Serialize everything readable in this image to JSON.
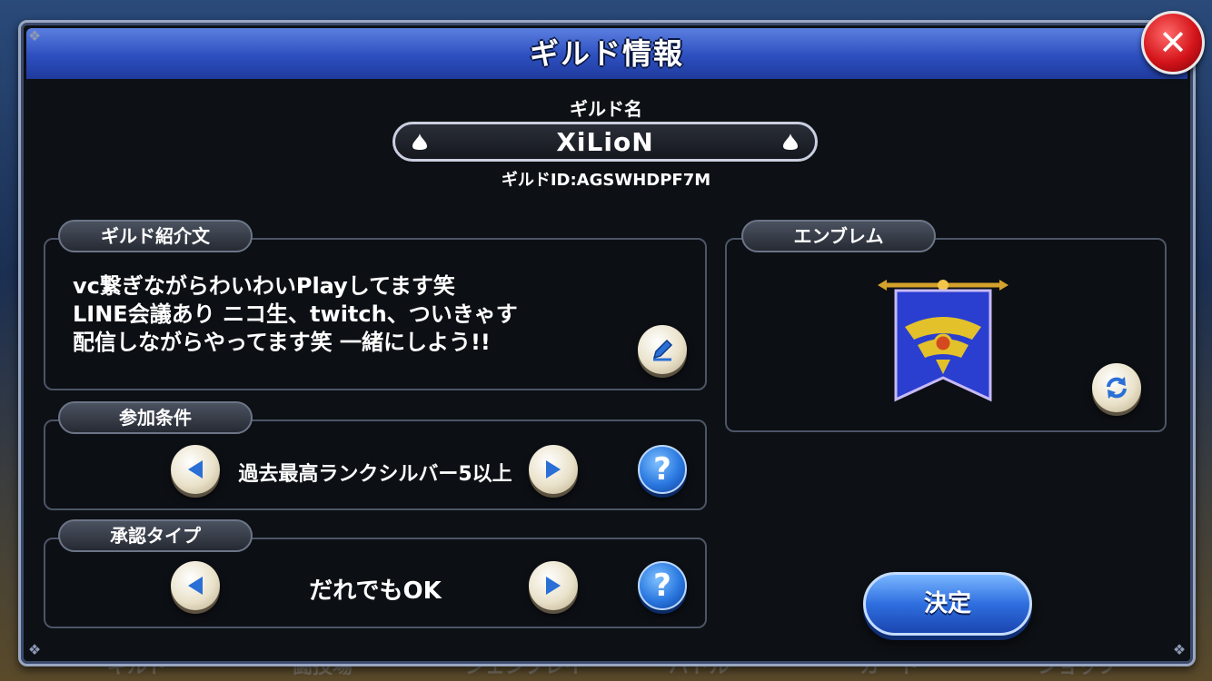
{
  "background": {
    "tabs": [
      "ギルド",
      "闘技場",
      "ジェンプレイ",
      "バトル",
      "カード",
      "ショップ"
    ]
  },
  "dialog": {
    "title": "ギルド情報",
    "close_label": "✕",
    "guild_name_label": "ギルド名",
    "guild_name_value": "XiLioN",
    "guild_id": "ギルドID:AGSWHDPF7M"
  },
  "intro": {
    "tab_label": "ギルド紹介文",
    "lines": [
      "vc繋ぎながらわいわいPlayしてます笑",
      "LINE会議あり ニコ生、twitch、ついきゃす",
      "配信しながらやってます笑 一緒にしよう!!"
    ]
  },
  "emblem": {
    "tab_label": "エンブレム"
  },
  "join_condition": {
    "tab_label": "参加条件",
    "value": "過去最高ランクシルバー5以上",
    "help_label": "?"
  },
  "approval_type": {
    "tab_label": "承認タイプ",
    "value": "だれでもOK",
    "help_label": "?"
  },
  "decide_button": {
    "label": "決定"
  },
  "colors": {
    "title_bar": "#2d4fbf",
    "close_button": "#d4141a",
    "decide_button": "#2f6fe0",
    "panel_border": "#4c5566"
  }
}
